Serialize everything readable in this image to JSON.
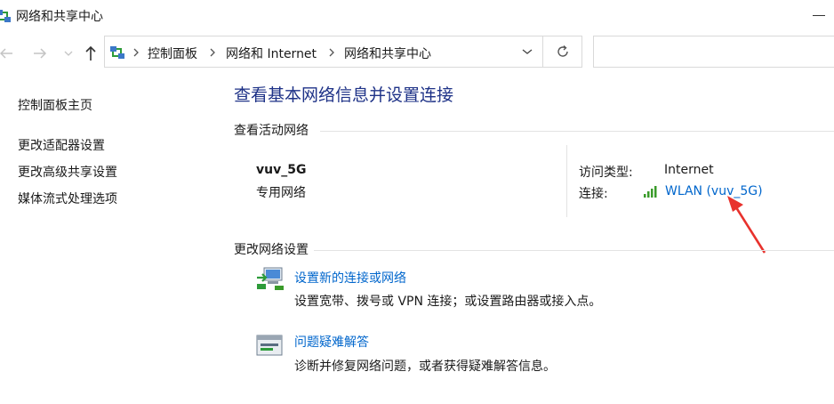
{
  "window": {
    "title": "网络和共享中心"
  },
  "address_bar": {
    "breadcrumbs": [
      "控制面板",
      "网络和 Internet",
      "网络和共享中心"
    ]
  },
  "sidebar": {
    "items": [
      {
        "label": "控制面板主页"
      },
      {
        "label": "更改适配器设置"
      },
      {
        "label": "更改高级共享设置"
      },
      {
        "label": "媒体流式处理选项"
      }
    ]
  },
  "main": {
    "title": "查看基本网络信息并设置连接",
    "active_networks_heading": "查看活动网络",
    "network": {
      "name": "vuv_5G",
      "type": "专用网络",
      "access_type_label": "访问类型:",
      "access_type_value": "Internet",
      "connection_label": "连接:",
      "connection_value": "WLAN (vuv_5G)"
    },
    "change_settings_heading": "更改网络设置",
    "tasks": [
      {
        "link": "设置新的连接或网络",
        "description": "设置宽带、拨号或 VPN 连接；或设置路由器或接入点。",
        "icon": "network-setup-icon"
      },
      {
        "link": "问题疑难解答",
        "description": "诊断并修复网络问题，或者获得疑难解答信息。",
        "icon": "troubleshoot-icon"
      }
    ]
  },
  "colors": {
    "link": "#0066cc",
    "title": "#1e3287",
    "annotation": "#e8322d",
    "signal": "#3a9b2a"
  }
}
